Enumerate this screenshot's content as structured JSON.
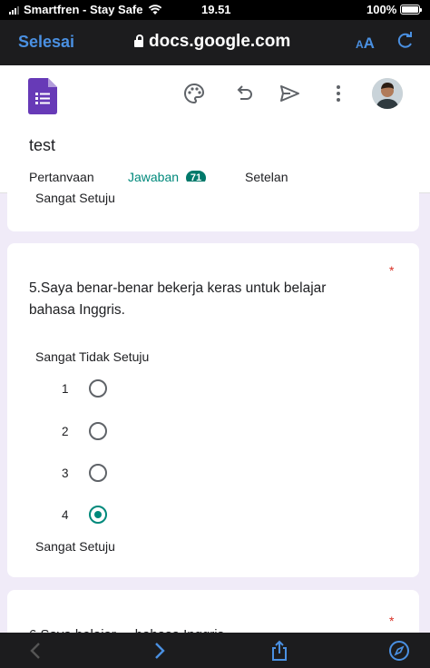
{
  "status_bar": {
    "carrier": "Smartfren - Stay Safe",
    "time": "19.51",
    "battery": "100%"
  },
  "browser": {
    "done_label": "Selesai",
    "url": "docs.google.com",
    "text_size_label_small": "A",
    "text_size_label_large": "A"
  },
  "form": {
    "title": "test",
    "tabs": [
      {
        "label": "Pertanyaan"
      },
      {
        "label": "Jawaban",
        "badge": "71"
      },
      {
        "label": "Setelan"
      }
    ],
    "active_tab": 1
  },
  "previous_card": {
    "label": "Sangat Setuju"
  },
  "question_card": {
    "required_mark": "*",
    "question": "5.Saya benar-benar bekerja keras untuk belajar bahasa Inggris.",
    "low_label": "Sangat Tidak Setuju",
    "high_label": "Sangat Setuju",
    "options": [
      {
        "value": "1",
        "selected": false
      },
      {
        "value": "2",
        "selected": false
      },
      {
        "value": "3",
        "selected": false
      },
      {
        "value": "4",
        "selected": true
      }
    ]
  },
  "next_card": {
    "required_mark": "*",
    "question_partial": "6.Saya belajar ... bahasa Inggris"
  },
  "colors": {
    "accent": "#00897b",
    "browser_blue": "#4a90e2",
    "forms_purple": "#673ab7",
    "background": "#f0ebf8"
  },
  "icons": {
    "header": [
      "palette-icon",
      "undo-icon",
      "send-icon",
      "more-vert-icon"
    ],
    "toolbar": [
      "back-icon",
      "forward-icon",
      "share-icon",
      "compass-icon"
    ]
  }
}
